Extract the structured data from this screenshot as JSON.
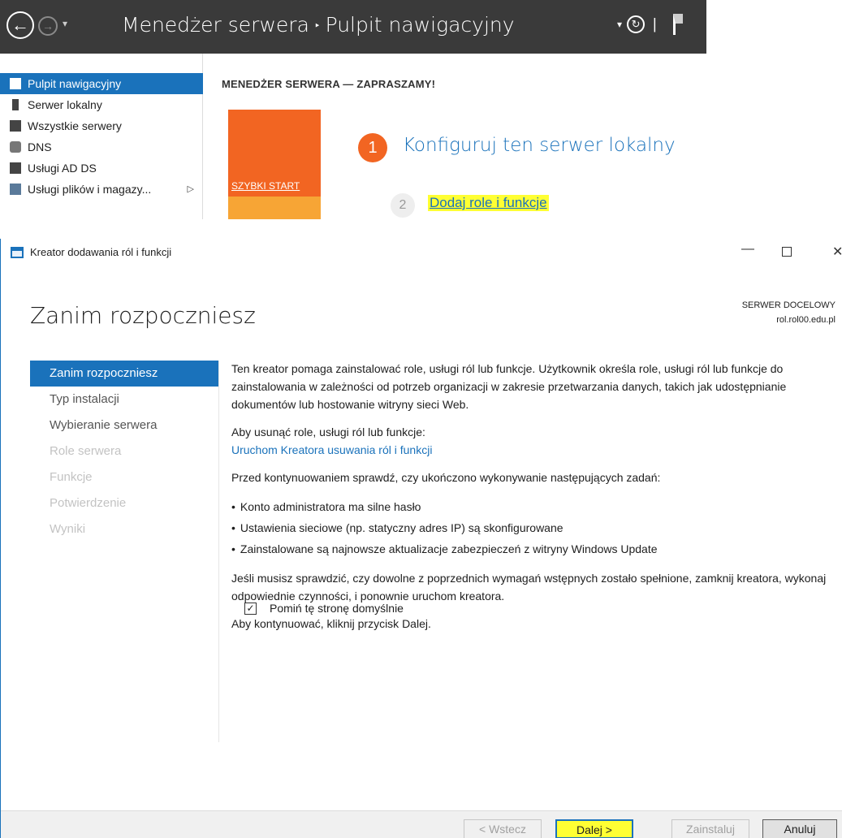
{
  "server_manager": {
    "title": "Menedżer serwera",
    "separator": "‣",
    "page": "Pulpit nawigacyjny",
    "dropdown_glyph": "▾",
    "back_glyph": "←",
    "forward_glyph": "→",
    "nav": [
      {
        "label": "Pulpit nawigacyjny",
        "icon": "dashboard-icon"
      },
      {
        "label": "Serwer lokalny",
        "icon": "server-icon"
      },
      {
        "label": "Wszystkie serwery",
        "icon": "servers-icon"
      },
      {
        "label": "DNS",
        "icon": "dns-icon"
      },
      {
        "label": "Usługi AD DS",
        "icon": "ad-ds-icon"
      },
      {
        "label": "Usługi plików i magazy...",
        "icon": "file-services-icon"
      }
    ],
    "nav_caret": "▷",
    "welcome": "MENEDŻER SERWERA — ZAPRASZAMY!",
    "quick_start": "SZYBKI START",
    "step1_num": "1",
    "step1_text": "Konfiguruj ten serwer lokalny",
    "step2_num": "2",
    "step2_text": "Dodaj role i funkcje"
  },
  "wizard": {
    "window_title": "Kreator dodawania ról i funkcji",
    "heading": "Zanim rozpoczniesz",
    "dest_label": "SERWER DOCELOWY",
    "dest_value": "rol.rol00.edu.pl",
    "steps": [
      {
        "label": "Zanim rozpoczniesz",
        "state": "active"
      },
      {
        "label": "Typ instalacji",
        "state": "enabled"
      },
      {
        "label": "Wybieranie serwera",
        "state": "enabled"
      },
      {
        "label": "Role serwera",
        "state": "disabled"
      },
      {
        "label": "Funkcje",
        "state": "disabled"
      },
      {
        "label": "Potwierdzenie",
        "state": "disabled"
      },
      {
        "label": "Wyniki",
        "state": "disabled"
      }
    ],
    "intro": "Ten kreator pomaga zainstalować role, usługi ról lub funkcje. Użytkownik określa role, usługi ról lub funkcje do zainstalowania w zależności od potrzeb organizacji w zakresie przetwarzania danych, takich jak udostępnianie dokumentów lub hostowanie witryny sieci Web.",
    "remove_label": "Aby usunąć role, usługi ról lub funkcje:",
    "remove_link": "Uruchom Kreatora usuwania ról i funkcji",
    "check_intro": "Przed kontynuowaniem sprawdź, czy ukończono wykonywanie następujących zadań:",
    "bullets": [
      "Konto administratora ma silne hasło",
      "Ustawienia sieciowe (np. statyczny adres IP) są skonfigurowane",
      "Zainstalowane są najnowsze aktualizacje zabezpieczeń z witryny Windows Update"
    ],
    "note": "Jeśli musisz sprawdzić, czy dowolne z poprzednich wymagań wstępnych zostało spełnione, zamknij kreatora, wykonaj odpowiednie czynności, i ponownie uruchom kreatora.",
    "continue": "Aby kontynuować, kliknij przycisk Dalej.",
    "skip_checkbox_label": "Pomiń tę stronę domyślnie",
    "skip_checked_glyph": "✓",
    "buttons": {
      "back": "< Wstecz",
      "next": "Dalej >",
      "install": "Zainstaluj",
      "cancel": "Anuluj"
    },
    "controls": {
      "minimize": "—",
      "close": "✕"
    }
  }
}
